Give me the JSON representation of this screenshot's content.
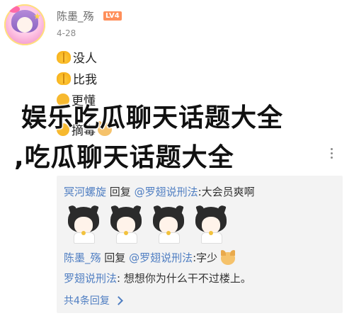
{
  "post": {
    "username": "陈墨_殇",
    "level_badge": "LV4",
    "date": "4-28",
    "messages": [
      "没人",
      "比我",
      "更懂",
      "摘毒"
    ]
  },
  "overlay": {
    "line1": "娱乐吃瓜聊天话题大全",
    "line2": ",吃瓜聊天话题大全"
  },
  "replies": {
    "r1": {
      "author": "冥河螺旋",
      "reply_word": "回复",
      "target": "@罗翅说刑法",
      "text": ":大会员爽啊"
    },
    "r2": {
      "author": "陈墨_殇",
      "reply_word": "回复",
      "target": "@罗翅说刑法",
      "text": ":字少"
    },
    "r3": {
      "author": "罗翅说刑法",
      "text": ": 想想你为什么干不过楼上。"
    },
    "see_all": "共4条回复"
  },
  "icons": {
    "avatar": "avatar-anime-girl",
    "msg_icons": [
      "raised-hands-icon",
      "raised-hands-icon",
      "fist-icon",
      "fist-icon"
    ],
    "dog": "dog-face-icon",
    "more": "more-vertical-icon",
    "chevron": "chevron-right-icon"
  },
  "colors": {
    "link_blue": "#4f7ec2",
    "level_orange": "#ff8f5a",
    "reply_bg": "#f3f3f3"
  }
}
